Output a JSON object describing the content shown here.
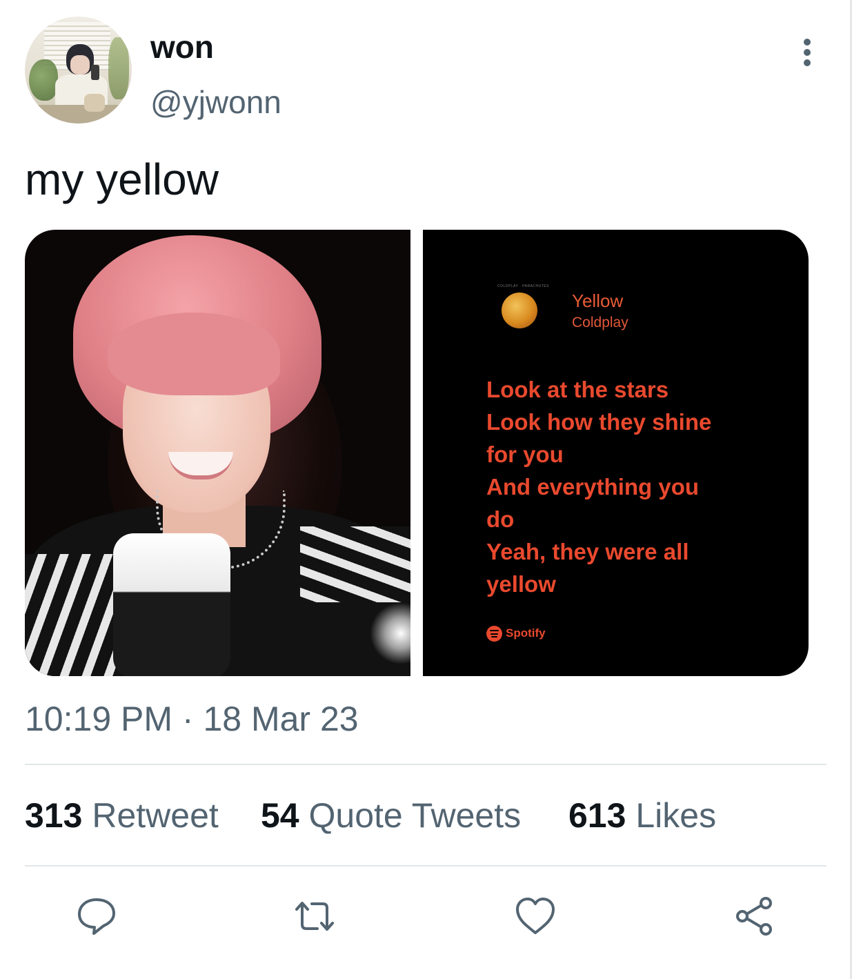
{
  "user": {
    "display_name": "won",
    "handle": "@yjwonn"
  },
  "tweet": {
    "text": "my yellow",
    "timestamp": "10:19 PM · 18 Mar 23"
  },
  "lyrics_card": {
    "album_caption": "COLDPLAY · PARACHUTES",
    "song_title": "Yellow",
    "artist": "Coldplay",
    "lyrics": [
      "Look at the stars",
      "Look how they shine",
      "for you",
      "And everything you",
      "do",
      "Yeah, they were all",
      "yellow"
    ],
    "brand": "Spotify",
    "text_color": "#e9492e",
    "background": "#000000"
  },
  "stats": {
    "retweets_count": "313",
    "retweets_label": "Retweet",
    "quotes_count": "54",
    "quotes_label": "Quote Tweets",
    "likes_count": "613",
    "likes_label": "Likes"
  },
  "actions": [
    "reply-icon",
    "retweet-icon",
    "like-icon",
    "share-icon"
  ],
  "colors": {
    "secondary_text": "#536471",
    "primary_text": "#0f1419",
    "divider": "#e3e6e8"
  }
}
